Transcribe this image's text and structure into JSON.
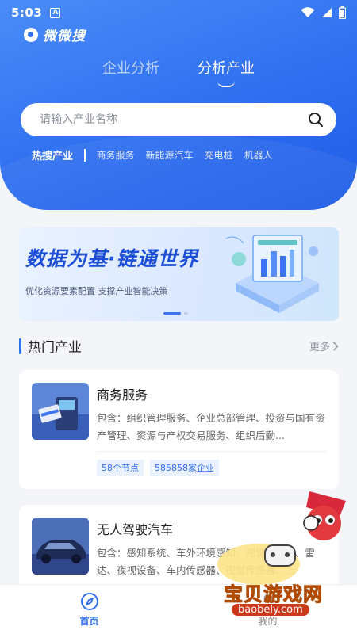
{
  "status_bar": {
    "time": "5:03",
    "indicator": "A"
  },
  "app": {
    "logo_text": "微微搜"
  },
  "tabs": [
    {
      "label": "企业分析",
      "active": false
    },
    {
      "label": "分析产业",
      "active": true
    }
  ],
  "search": {
    "placeholder": "请输入产业名称"
  },
  "hot_search": {
    "label": "热搜产业",
    "tags": [
      "商务服务",
      "新能源汽车",
      "充电桩",
      "机器人"
    ]
  },
  "banner": {
    "title": "数据为基·链通世界",
    "subtitle": "优化资源要素配置 支撑产业智能决策",
    "slide_count": 2,
    "active_slide": 0
  },
  "section": {
    "title": "热门产业",
    "more_label": "更多"
  },
  "cards": [
    {
      "title": "商务服务",
      "desc": "包含：组织管理服务、企业总部管理、投资与国有资产管理、资源与产权交易服务、组织后勤...",
      "tags": [
        "58个节点",
        "585858家企业"
      ]
    },
    {
      "title": "无人驾驶汽车",
      "desc": "包含：感知系统、车外环境感知、视觉摄像头、雷达、夜视设备、车内传感器、视觉传感器、..."
    }
  ],
  "bottom_nav": [
    {
      "label": "首页",
      "active": true
    },
    {
      "label": "我的",
      "active": false
    }
  ],
  "watermark": {
    "text": "宝贝游戏网",
    "url": "baobely.com"
  },
  "colors": {
    "primary": "#2f6ff0",
    "hero_light": "#4a8df8",
    "background": "#f3f5f9"
  }
}
